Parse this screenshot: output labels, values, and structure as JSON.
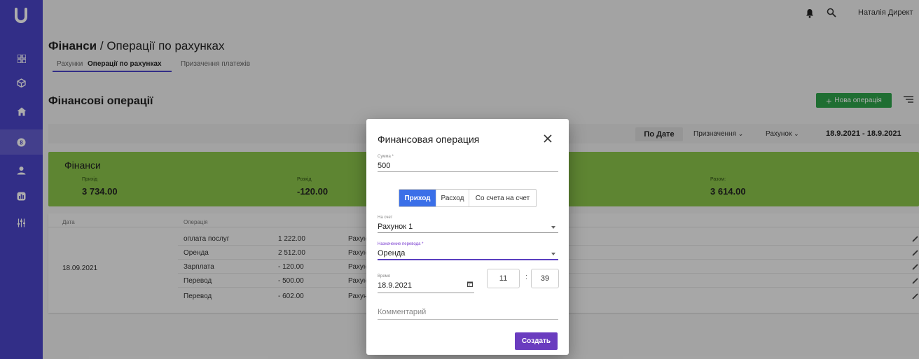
{
  "topbar": {
    "user": "Наталія Директ"
  },
  "header": {
    "title_section": "Фінанси",
    "title_sep": " / ",
    "title_page": "Операції по рахунках",
    "tabs": [
      {
        "label": "Рахунки"
      },
      {
        "label": "Операції по рахунках"
      },
      {
        "label": "Призачення платежів"
      }
    ]
  },
  "section": {
    "title": "Фінансові операції",
    "new_button": "Нова операція"
  },
  "filters": {
    "by_date": "По Дате",
    "purpose": "Призначення",
    "account": "Рахунок",
    "range": "18.9.2021 - 18.9.2021"
  },
  "summary": {
    "title": "Фінанси",
    "income_label": "Прихід",
    "income_value": "3 734.00",
    "expense_label": "Розхід",
    "expense_value": "-120.00",
    "total_label": "Разом:",
    "total_value": "3 614.00"
  },
  "table": {
    "columns": [
      "Дата",
      "Операція"
    ],
    "date": "18.09.2021",
    "rows": [
      {
        "operation": "оплата послуг",
        "amount": "1 222.00",
        "account": "Рахун"
      },
      {
        "operation": "Оренда",
        "amount": "2 512.00",
        "account": "Рахун"
      },
      {
        "operation": "Зарплата",
        "amount": "- 120.00",
        "account": "Рахун"
      },
      {
        "operation": "Перевод",
        "amount": "- 500.00",
        "account": "Рахун"
      },
      {
        "operation": "Перевод",
        "amount": "- 602.00",
        "account": "Рахун"
      }
    ]
  },
  "dialog": {
    "title": "Финансовая операция",
    "amount_label": "Сумма *",
    "amount_value": "500",
    "types": [
      "Приход",
      "Расход",
      "Со счета на счет"
    ],
    "selected_type": "Приход",
    "to_account_label": "На счет",
    "to_account_value": "Рахунок 1",
    "purpose_label": "Назначение перевода *",
    "purpose_value": "Оренда",
    "time_label": "Время",
    "date_value": "18.9.2021",
    "hour": "11",
    "minute": "39",
    "time_sep": ":",
    "comment_placeholder": "Комментарий",
    "create_button": "Создать"
  },
  "colors": {
    "sidebar": "#4b44c8",
    "summary_green": "#8bc54b",
    "new_button_green": "#2fa24a",
    "toggle_blue": "#3a6fe8",
    "create_purple": "#6a3cbf"
  }
}
